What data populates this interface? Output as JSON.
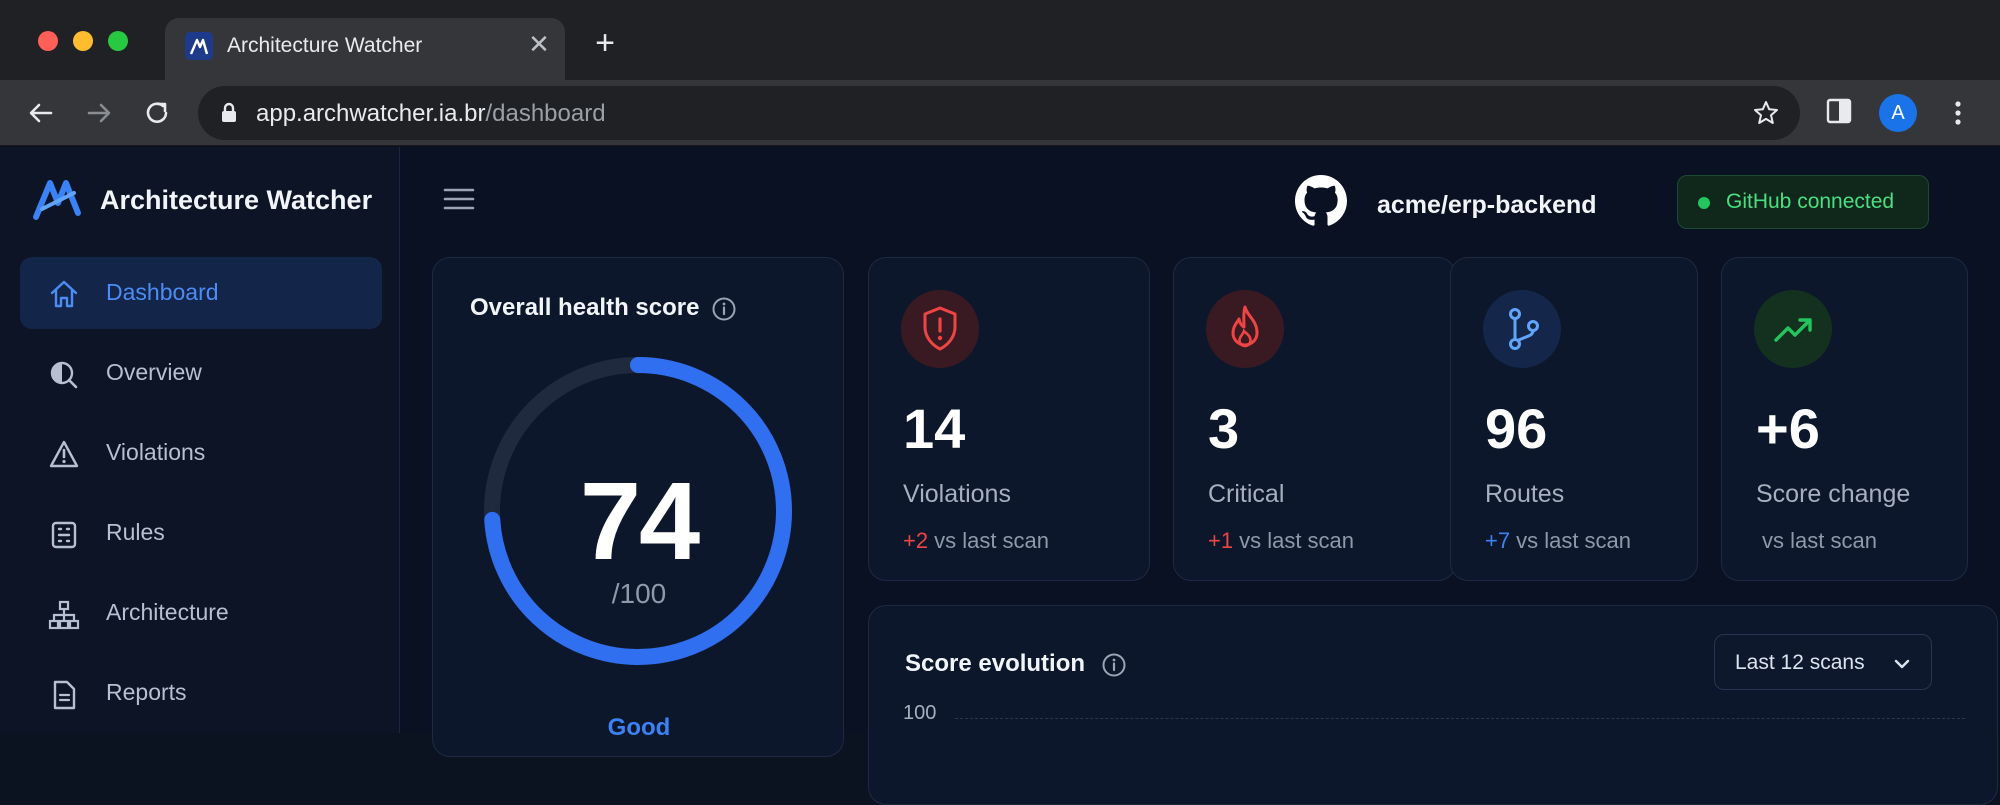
{
  "browser": {
    "tab_title": "Architecture Watcher",
    "url_host": "app.archwatcher.ia.br",
    "url_path": "/dashboard",
    "avatar_initial": "A"
  },
  "sidebar": {
    "brand": "Architecture Watcher",
    "items": [
      {
        "label": "Dashboard",
        "icon": "home-icon",
        "active": true
      },
      {
        "label": "Overview",
        "icon": "overview-icon",
        "active": false
      },
      {
        "label": "Violations",
        "icon": "warning-icon",
        "active": false
      },
      {
        "label": "Rules",
        "icon": "rules-icon",
        "active": false
      },
      {
        "label": "Architecture",
        "icon": "hierarchy-icon",
        "active": false
      },
      {
        "label": "Reports",
        "icon": "document-icon",
        "active": false
      }
    ]
  },
  "header": {
    "repo": "acme/erp-backend",
    "github_status": "GitHub connected"
  },
  "health": {
    "title": "Overall health score",
    "score": "74",
    "max": "/100",
    "score_fraction": 0.74,
    "label": "Good"
  },
  "stats": [
    {
      "value": "14",
      "label": "Violations",
      "delta": "+2",
      "delta_suffix": "vs last scan",
      "icon": "shield-alert-icon",
      "accent": "#ef4444"
    },
    {
      "value": "3",
      "label": "Critical",
      "delta": "+1",
      "delta_suffix": "vs last scan",
      "icon": "flame-icon",
      "accent": "#ef4444"
    },
    {
      "value": "96",
      "label": "Routes",
      "delta": "+7",
      "delta_suffix": "vs last scan",
      "icon": "branch-icon",
      "accent": "#3b82f6"
    },
    {
      "value": "+6",
      "label": "Score change",
      "delta": "",
      "delta_suffix": "vs last scan",
      "icon": "trending-up-icon",
      "accent": "#22c55e"
    }
  ],
  "evolution": {
    "title": "Score evolution",
    "range": "Last 12 scans",
    "y_top": "100"
  }
}
